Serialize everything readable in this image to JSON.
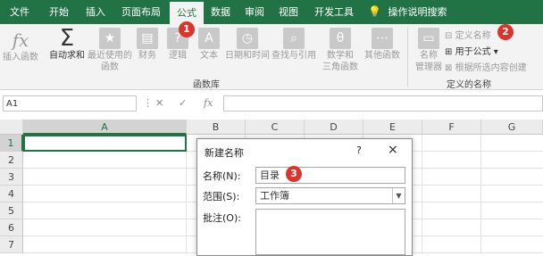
{
  "tabs": [
    "文件",
    "开始",
    "插入",
    "页面布局",
    "公式",
    "数据",
    "审阅",
    "视图",
    "开发工具"
  ],
  "tell_me": "操作说明搜索",
  "ribbon": {
    "insert_function": "插入函数",
    "autosum": "自动求和",
    "recent": [
      "最近使用的",
      "函数"
    ],
    "financial": "财务",
    "logical": "逻辑",
    "text": "文本",
    "datetime": "日期和时间",
    "lookup": "查找与引用",
    "math": [
      "数学和",
      "三角函数"
    ],
    "more": "其他函数",
    "group_library": "函数库",
    "name_manager": [
      "名称",
      "管理器"
    ],
    "define_name": "定义名称",
    "use_in_formula": "用于公式",
    "create_from_selection": "根据所选内容创建",
    "group_defined_names": "定义的名称"
  },
  "badges": [
    "1",
    "2",
    "3"
  ],
  "formula_bar": {
    "name_box": "A1",
    "fx": "fx"
  },
  "grid": {
    "columns": [
      "A",
      "B",
      "C",
      "D",
      "E",
      "F",
      "G"
    ],
    "rows": [
      "1",
      "2",
      "3",
      "4",
      "5",
      "6",
      "7"
    ]
  },
  "dialog": {
    "title": "新建名称",
    "help": "?",
    "close": "×",
    "name_label": "名称(N):",
    "name_value": "目录",
    "scope_label": "范围(S):",
    "scope_value": "工作簿",
    "comment_label": "批注(O):"
  },
  "colors": {
    "accent": "#217346",
    "badge": "#d9352b"
  }
}
